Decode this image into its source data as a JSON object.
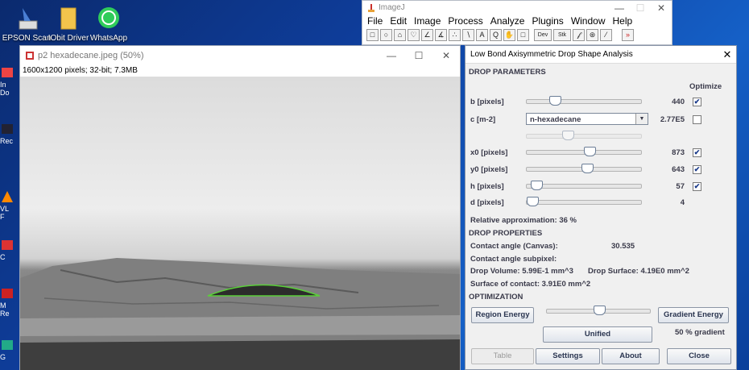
{
  "desktop": {
    "icons": [
      {
        "label": "EPSON Scan",
        "icon": "epson-scan-icon"
      },
      {
        "label": "IObit Driver",
        "icon": "folder-icon"
      },
      {
        "label": "WhatsApp",
        "icon": "whatsapp-icon"
      }
    ],
    "side_labels": [
      "In",
      "Do",
      "Rec",
      "VL",
      "F",
      "C",
      "M",
      "Re",
      "G"
    ]
  },
  "image_window": {
    "title": "p2 hexadecane.jpeg (50%)",
    "info": "1600x1200 pixels; 32-bit; 7.3MB",
    "min": "—",
    "max": "☐",
    "close": "✕"
  },
  "imagej": {
    "title": "ImageJ",
    "min": "—",
    "max": "☐",
    "close": "✕",
    "menu": [
      "File",
      "Edit",
      "Image",
      "Process",
      "Analyze",
      "Plugins",
      "Window",
      "Help"
    ],
    "tools": [
      "□",
      "○",
      "⌂",
      "♡",
      "∠",
      "∡",
      "∴",
      "∖",
      "A",
      "Q",
      "✋",
      "□",
      "Dev",
      "Stk",
      "𝒻",
      "⊛",
      "⁄",
      "»"
    ]
  },
  "dialog": {
    "title": "Low Bond Axisymmetric Drop Shape Analysis",
    "close": "✕",
    "section_drop_params": "DROP PARAMETERS",
    "optimize_header": "Optimize",
    "params": [
      {
        "label": "b [pixels]",
        "value": "440",
        "checked": true,
        "level": 0.22
      },
      {
        "label": "x0 [pixels]",
        "value": "873",
        "checked": true,
        "level": 0.55
      },
      {
        "label": "y0 [pixels]",
        "value": "643",
        "checked": true,
        "level": 0.53
      },
      {
        "label": "h [pixels]",
        "value": "57",
        "checked": true,
        "level": 0.04
      },
      {
        "label": "d [pixels]",
        "value": "4",
        "checked": false,
        "level": 0.0
      }
    ],
    "c_label": "c [m-2]",
    "c_select": "n-hexadecane",
    "c_value": "2.77E5",
    "c_checked": false,
    "relative_approx": "Relative approximation: 36 %",
    "section_drop_props": "DROP PROPERTIES",
    "contact_angle_canvas_label": "Contact angle (Canvas):",
    "contact_angle_canvas_value": "30.535",
    "contact_angle_subpixel": "Contact angle subpixel:",
    "drop_volume": "Drop Volume: 5.99E-1 mm^3",
    "drop_surface": "Drop Surface: 4.19E0 mm^2",
    "surface_contact": "Surface of contact: 3.91E0 mm^2",
    "section_optimization": "OPTIMIZATION",
    "region_energy": "Region Energy",
    "gradient_energy": "Gradient Energy",
    "unified": "Unified",
    "gradient_pct": "50 % gradient",
    "opt_level": 0.5,
    "buttons": {
      "table": "Table",
      "settings": "Settings",
      "about": "About",
      "close": "Close"
    }
  }
}
